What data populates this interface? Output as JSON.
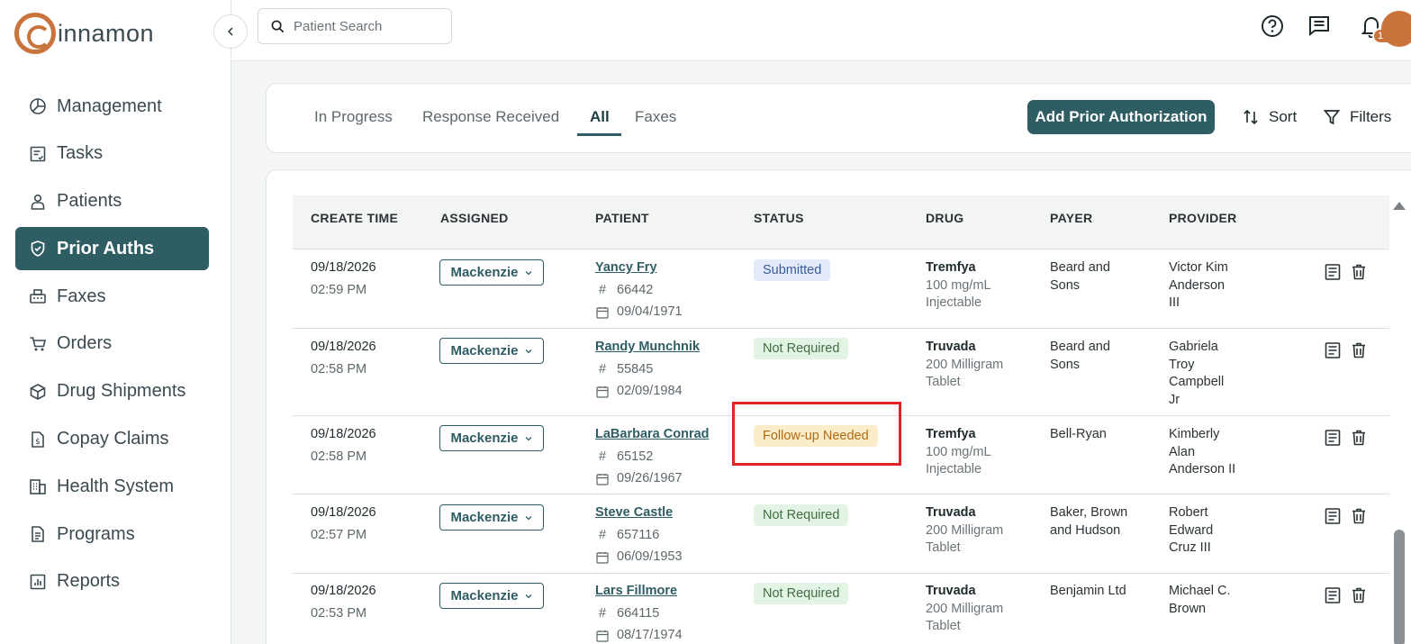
{
  "brand": {
    "name": "innamon",
    "accent": "#c8743c",
    "primary": "#2f5d64"
  },
  "sidebar": {
    "items": [
      {
        "label": "Management",
        "icon": "chart-pie-icon"
      },
      {
        "label": "Tasks",
        "icon": "task-list-icon"
      },
      {
        "label": "Patients",
        "icon": "patient-icon"
      },
      {
        "label": "Prior Auths",
        "icon": "shield-check-icon",
        "active": true
      },
      {
        "label": "Faxes",
        "icon": "fax-icon"
      },
      {
        "label": "Orders",
        "icon": "cart-icon"
      },
      {
        "label": "Drug Shipments",
        "icon": "package-icon"
      },
      {
        "label": "Copay Claims",
        "icon": "dollar-doc-icon"
      },
      {
        "label": "Health System",
        "icon": "building-icon"
      },
      {
        "label": "Programs",
        "icon": "document-icon"
      },
      {
        "label": "Reports",
        "icon": "report-icon"
      }
    ]
  },
  "topbar": {
    "search_placeholder": "Patient Search",
    "notification_count": "19"
  },
  "tabs": {
    "items": [
      "In Progress",
      "Response Received",
      "All",
      "Faxes"
    ],
    "active": "All",
    "add_button": "Add Prior Authorization",
    "sort_label": "Sort",
    "filters_label": "Filters"
  },
  "table": {
    "columns": [
      "CREATE TIME",
      "ASSIGNED",
      "PATIENT",
      "STATUS",
      "DRUG",
      "PAYER",
      "PROVIDER"
    ],
    "rows": [
      {
        "date": "09/18/2026",
        "time": "02:59 PM",
        "assigned": "Mackenzie",
        "patient": "Yancy Fry",
        "patient_id": "66442",
        "dob": "09/04/1971",
        "status": "Submitted",
        "drug": "Tremfya",
        "drug_l1": "100 mg/mL",
        "drug_l2": "Injectable",
        "payer_l1": "Beard and",
        "payer_l2": "Sons",
        "prov_l1": "Victor Kim",
        "prov_l2": "Anderson",
        "prov_l3": "III",
        "prov_l4": ""
      },
      {
        "date": "09/18/2026",
        "time": "02:58 PM",
        "assigned": "Mackenzie",
        "patient": "Randy Munchnik",
        "patient_id": "55845",
        "dob": "02/09/1984",
        "status": "Not Required",
        "drug": "Truvada",
        "drug_l1": "200 Milligram",
        "drug_l2": "Tablet",
        "payer_l1": "Beard and",
        "payer_l2": "Sons",
        "prov_l1": "Gabriela",
        "prov_l2": "Troy",
        "prov_l3": "Campbell",
        "prov_l4": "Jr"
      },
      {
        "date": "09/18/2026",
        "time": "02:58 PM",
        "assigned": "Mackenzie",
        "patient": "LaBarbara Conrad",
        "patient_id": "65152",
        "dob": "09/26/1967",
        "status": "Follow-up Needed",
        "drug": "Tremfya",
        "drug_l1": "100 mg/mL",
        "drug_l2": "Injectable",
        "payer_l1": "Bell-Ryan",
        "payer_l2": "",
        "prov_l1": "Kimberly",
        "prov_l2": "Alan",
        "prov_l3": "Anderson II",
        "prov_l4": ""
      },
      {
        "date": "09/18/2026",
        "time": "02:57 PM",
        "assigned": "Mackenzie",
        "patient": "Steve Castle",
        "patient_id": "657116",
        "dob": "06/09/1953",
        "status": "Not Required",
        "drug": "Truvada",
        "drug_l1": "200 Milligram",
        "drug_l2": "Tablet",
        "payer_l1": "Baker, Brown",
        "payer_l2": "and Hudson",
        "prov_l1": "Robert",
        "prov_l2": "Edward",
        "prov_l3": "Cruz III",
        "prov_l4": ""
      },
      {
        "date": "09/18/2026",
        "time": "02:53 PM",
        "assigned": "Mackenzie",
        "patient": "Lars Fillmore",
        "patient_id": "664115",
        "dob": "08/17/1974",
        "status": "Not Required",
        "drug": "Truvada",
        "drug_l1": "200 Milligram",
        "drug_l2": "Tablet",
        "payer_l1": "Benjamin Ltd",
        "payer_l2": "",
        "prov_l1": "Michael C.",
        "prov_l2": "Brown",
        "prov_l3": "",
        "prov_l4": ""
      }
    ]
  }
}
